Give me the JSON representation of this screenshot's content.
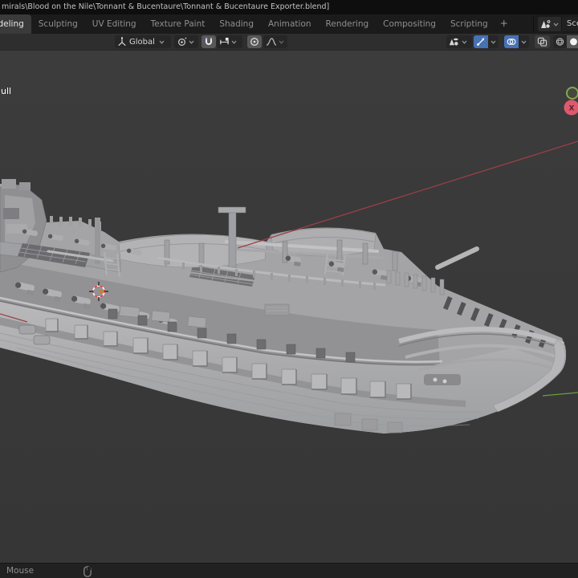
{
  "window": {
    "title_visible": "mirals\\Blood on the Nile\\Tonnant & Bucentaure\\Tonnant & Bucentaure Exporter.blend]"
  },
  "workspace_tabs": {
    "tabs": [
      {
        "label": "Modeling",
        "active": true
      },
      {
        "label": "Sculpting",
        "active": false
      },
      {
        "label": "UV Editing",
        "active": false
      },
      {
        "label": "Texture Paint",
        "active": false
      },
      {
        "label": "Shading",
        "active": false
      },
      {
        "label": "Animation",
        "active": false
      },
      {
        "label": "Rendering",
        "active": false
      },
      {
        "label": "Compositing",
        "active": false
      },
      {
        "label": "Scripting",
        "active": false
      }
    ],
    "add_label": "+"
  },
  "scene_selector": {
    "label": "Scene"
  },
  "tool_header": {
    "orientation_label": "Global"
  },
  "viewport": {
    "object_hint": "ull",
    "axis_gizmo_x_label": "X",
    "colors": {
      "background": "#3a3a3a",
      "model_gray": "#aeaeb1",
      "accent_blue": "#4772b3",
      "axis_x_red": "#a04048",
      "axis_y_green": "#6b9e3e",
      "cursor_red": "#e04343"
    }
  },
  "status_bar": {
    "left_hint": "Mouse"
  },
  "icons": [
    "scene-icon",
    "transform-orientation-icon",
    "chevron-down-icon",
    "pivot-point-icon",
    "snap-magnet-icon",
    "snap-target-icon",
    "proportional-editing-icon",
    "falloff-curve-icon",
    "object-visibility-icon",
    "gizmo-icon",
    "overlays-icon",
    "xray-toggle-icon",
    "wireframe-shading-icon",
    "solid-shading-icon",
    "mouse-icon"
  ]
}
